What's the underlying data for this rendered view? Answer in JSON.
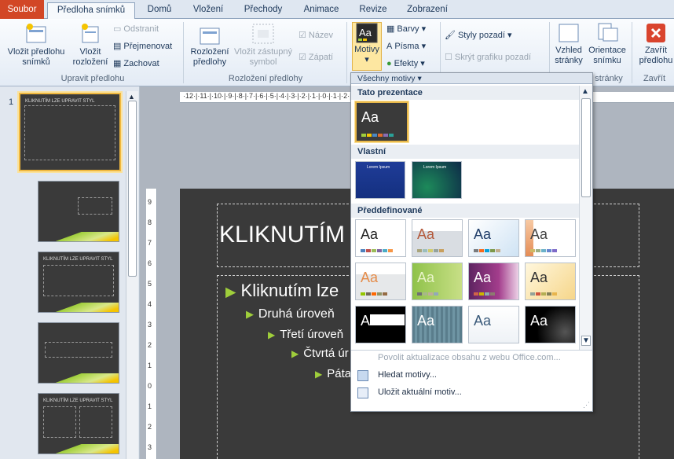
{
  "tabs": [
    {
      "label": "Soubor"
    },
    {
      "label": "Předloha snímků"
    },
    {
      "label": "Domů"
    },
    {
      "label": "Vložení"
    },
    {
      "label": "Přechody"
    },
    {
      "label": "Animace"
    },
    {
      "label": "Revize"
    },
    {
      "label": "Zobrazení"
    }
  ],
  "ribbon": {
    "insert_master_1": "Vložit předlohu",
    "insert_master_2": "snímků",
    "insert_layout_1": "Vložit",
    "insert_layout_2": "rozložení",
    "delete": "Odstranit",
    "rename": "Přejmenovat",
    "preserve": "Zachovat",
    "group_edit": "Upravit předlohu",
    "master_layout_1": "Rozložení",
    "master_layout_2": "předlohy",
    "placeholder_1": "Vložit zástupný",
    "placeholder_2": "symbol",
    "title_cb": "Název",
    "footers_cb": "Zápatí",
    "group_layout": "Rozložení předlohy",
    "themes": "Motivy",
    "colors": "Barvy",
    "fonts": "Písma",
    "effects": "Efekty",
    "bg_styles": "Styly pozadí",
    "hide_bg": "Skrýt grafiku pozadí",
    "page_setup_1": "Vzhled",
    "page_setup_2": "stránky",
    "orientation_1": "Orientace",
    "orientation_2": "snímku",
    "group_page": "stránky",
    "close_1": "Zavřít",
    "close_2": "předlohu",
    "group_close": "Zavřít"
  },
  "thumbs": {
    "first_number": "1",
    "title_text": "KLIKNUTÍM LZE UPRAVIT STYL"
  },
  "ruler": {
    "h": "·12·|·11·|·10·|·9·|·8·|·7·|·6·|·5·|·4·|·3·|·2·|·1·|·0·|·1·|·2·|·3·|·4·|·5·|·6·|·7·|·8·|·9·|·10·|·11·|·12·",
    "v": [
      "9",
      "8",
      "7",
      "6",
      "5",
      "4",
      "3",
      "2",
      "1",
      "0",
      "1",
      "2",
      "3"
    ]
  },
  "slide": {
    "title": "KLIKNUTÍM",
    "l1": "Kliknutím lze",
    "l2": "Druhá úroveň",
    "l3": "Třetí úroveň",
    "l4": "Čtvrtá úr",
    "l5": "Páta"
  },
  "gallery": {
    "header": "Všechny motivy",
    "sec_current": "Tato prezentace",
    "sec_custom": "Vlastní",
    "sec_builtin": "Předdefinované",
    "aa": "Aa",
    "custom_thumb_text": "Lorem Ipsum",
    "enable_updates": "Povolit aktualizace obsahu z webu Office.com...",
    "browse": "Hledat motivy...",
    "save": "Uložit aktuální motiv..."
  },
  "colors": {
    "accent": "#d24726",
    "green": "#9fce3b",
    "slide_bg": "#3a3a3a"
  }
}
